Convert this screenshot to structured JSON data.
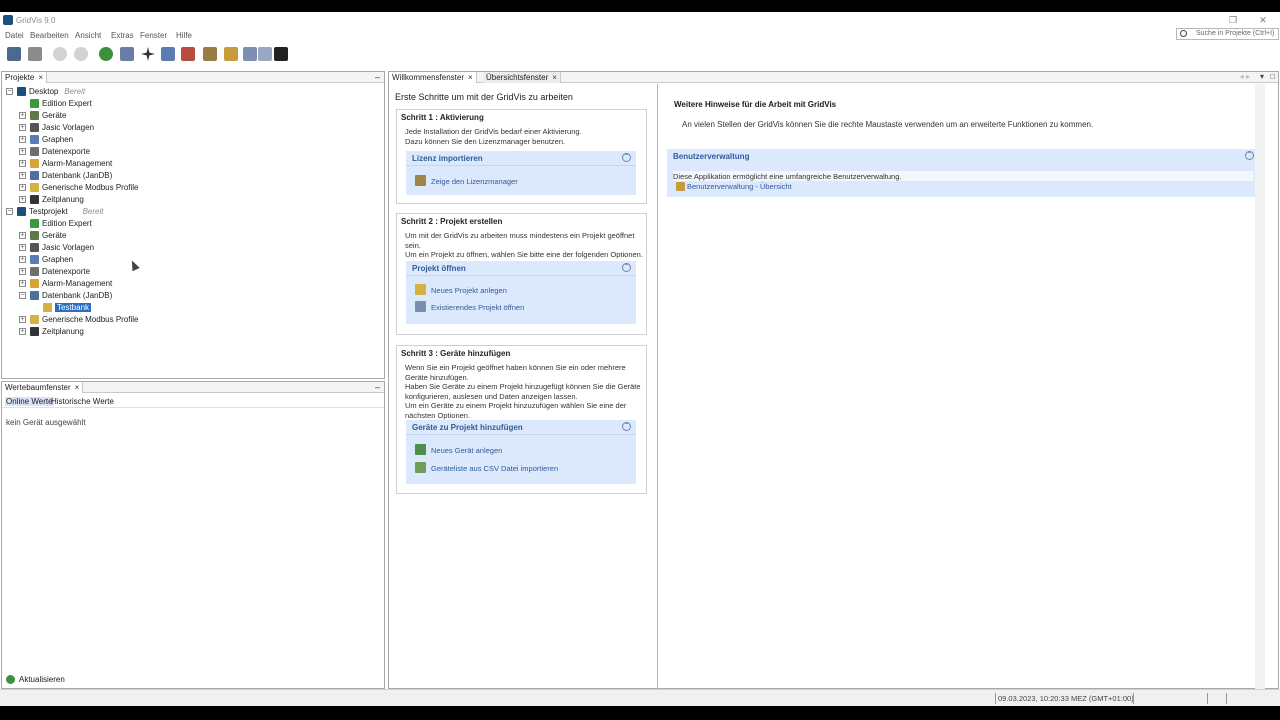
{
  "window": {
    "title": "GridVis 9.0"
  },
  "menu": [
    "Datei",
    "Bearbeiten",
    "Ansicht",
    "Extras",
    "Fenster",
    "Hilfe"
  ],
  "search": {
    "placeholder": "Suche in Projekte (Ctrl+I)"
  },
  "projects_panel": {
    "tab": "Projekte",
    "tree": [
      {
        "label": "Desktop",
        "note": "Bereit",
        "level": 0,
        "expander": "−"
      },
      {
        "label": "Edition Expert",
        "level": 1,
        "expander": ""
      },
      {
        "label": "Geräte",
        "level": 1,
        "expander": "+"
      },
      {
        "label": "Jasic Vorlagen",
        "level": 1,
        "expander": "+"
      },
      {
        "label": "Graphen",
        "level": 1,
        "expander": "+"
      },
      {
        "label": "Datenexporte",
        "level": 1,
        "expander": "+"
      },
      {
        "label": "Alarm-Management",
        "level": 1,
        "expander": "+"
      },
      {
        "label": "Datenbank (JanDB)",
        "level": 1,
        "expander": "+"
      },
      {
        "label": "Generische Modbus Profile",
        "level": 1,
        "expander": "+"
      },
      {
        "label": "Zeitplanung",
        "level": 1,
        "expander": "+"
      },
      {
        "label": "Testprojekt",
        "note": "Bereit",
        "level": 0,
        "expander": "−"
      },
      {
        "label": "Edition Expert",
        "level": 1,
        "expander": ""
      },
      {
        "label": "Geräte",
        "level": 1,
        "expander": "+"
      },
      {
        "label": "Jasic Vorlagen",
        "level": 1,
        "expander": "+"
      },
      {
        "label": "Graphen",
        "level": 1,
        "expander": "+"
      },
      {
        "label": "Datenexporte",
        "level": 1,
        "expander": "+"
      },
      {
        "label": "Alarm-Management",
        "level": 1,
        "expander": "+"
      },
      {
        "label": "Datenbank (JanDB)",
        "level": 1,
        "expander": "−"
      },
      {
        "label": "Testbank",
        "level": 2,
        "expander": "",
        "selected": true
      },
      {
        "label": "Generische Modbus Profile",
        "level": 1,
        "expander": "+"
      },
      {
        "label": "Zeitplanung",
        "level": 1,
        "expander": "+"
      }
    ]
  },
  "values_panel": {
    "tab": "Wertebaumfenster",
    "subtabs": [
      "Online Werte",
      "Historische Werte"
    ],
    "empty": "kein Gerät ausgewählt",
    "refresh": "Aktualisieren"
  },
  "editor_tabs": [
    "Willkommensfenster",
    "Übersichtsfenster"
  ],
  "welcome": {
    "heading": "Erste Schritte um mit der GridVis zu arbeiten",
    "step1": {
      "title": "Schritt 1 : Aktivierung",
      "text": [
        "Jede Installation der GridVis bedarf einer Aktivierung.",
        "Dazu können Sie den Lizenzmanager benutzen."
      ],
      "box_title": "Lizenz importieren",
      "links": [
        "Zeige den Lizenzmanager"
      ]
    },
    "step2": {
      "title": "Schritt 2 : Projekt erstellen",
      "text": [
        "Um mit der GridVis zu arbeiten muss mindestens ein Projekt geöffnet",
        "sein.",
        "Um ein Projekt zu öffnen, wählen Sie bitte eine der folgenden Optionen."
      ],
      "box_title": "Projekt öffnen",
      "links": [
        "Neues Projekt anlegen",
        "Existierendes Projekt öffnen"
      ]
    },
    "step3": {
      "title": "Schritt 3 : Geräte hinzufügen",
      "text": [
        "Wenn Sie ein Projekt geöffnet haben können Sie ein oder mehrere",
        "Geräte hinzufügen.",
        "Haben Sie Geräte zu einem Projekt hinzugefügt können Sie die Geräte",
        "konfigurieren, auslesen und Daten anzeigen lassen.",
        "Um ein Geräte zu einem Projekt hinzuzufügen wählen Sie eine der",
        "nächsten Optionen."
      ],
      "box_title": "Geräte zu Projekt hinzufügen",
      "links": [
        "Neues Gerät anlegen",
        "Geräteliste aus CSV Datei importieren"
      ]
    }
  },
  "hints": {
    "heading": "Weitere Hinweise für die Arbeit mit GridVis",
    "text": "An vielen Stellen der GridVis können Sie die rechte Maustaste verwenden um an erweiterte Funktionen zu kommen.",
    "box_title": "Benutzerverwaltung",
    "box_text": "Diese Applikation ermöglicht eine umfangreiche Benutzerverwaltung.",
    "links": [
      "Benutzerverwaltung - Übersicht"
    ]
  },
  "status": {
    "datetime": "09.03.2023, 10:20:33 MEZ (GMT+01:00)"
  },
  "colors": {
    "selection": "#2c6cc1",
    "box": "#dce8fb",
    "link": "#2f5c9c",
    "brand": "#1d4f7c"
  },
  "icons": [
    "app-icon",
    "search-icon",
    "open-project-icon",
    "save-icon",
    "undo-icon",
    "redo-icon",
    "refresh-icon",
    "device-icon",
    "network-icon",
    "chart-icon",
    "report-icon",
    "settings-icon",
    "user-icon",
    "graduation-icon",
    "project-icon",
    "folder-icon"
  ]
}
